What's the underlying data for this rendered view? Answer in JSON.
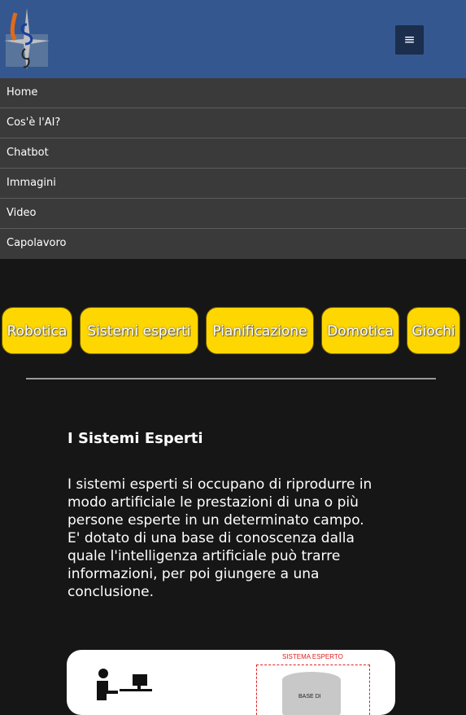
{
  "header": {
    "logo_alt": "LSG logo",
    "menu_icon": "hamburger-icon"
  },
  "nav": {
    "items": [
      {
        "label": "Home"
      },
      {
        "label": "Cos'è l'AI?"
      },
      {
        "label": "Chatbot"
      },
      {
        "label": "Immagini"
      },
      {
        "label": "Video"
      },
      {
        "label": "Capolavoro"
      }
    ]
  },
  "categories": [
    {
      "label": "Robotica"
    },
    {
      "label": "Sistemi esperti"
    },
    {
      "label": "Pianificazione"
    },
    {
      "label": "Domotica"
    },
    {
      "label": "Giochi"
    }
  ],
  "main": {
    "title": "I Sistemi Esperti",
    "paragraph": "I sistemi esperti si occupano di riprodurre in modo artificiale le prestazioni di una o più persone esperte in un determinato campo. E' dotato di una base di conoscenza dalla quale l'intelligenza artificiale può trarre informazioni, per poi giungere a una conclusione."
  },
  "diagram": {
    "label": "SISTEMA ESPERTO",
    "db_label": "BASE DI"
  },
  "colors": {
    "header": "#34578f",
    "nav": "#3a3a3a",
    "pill": "#ffd700",
    "background": "#161616"
  }
}
